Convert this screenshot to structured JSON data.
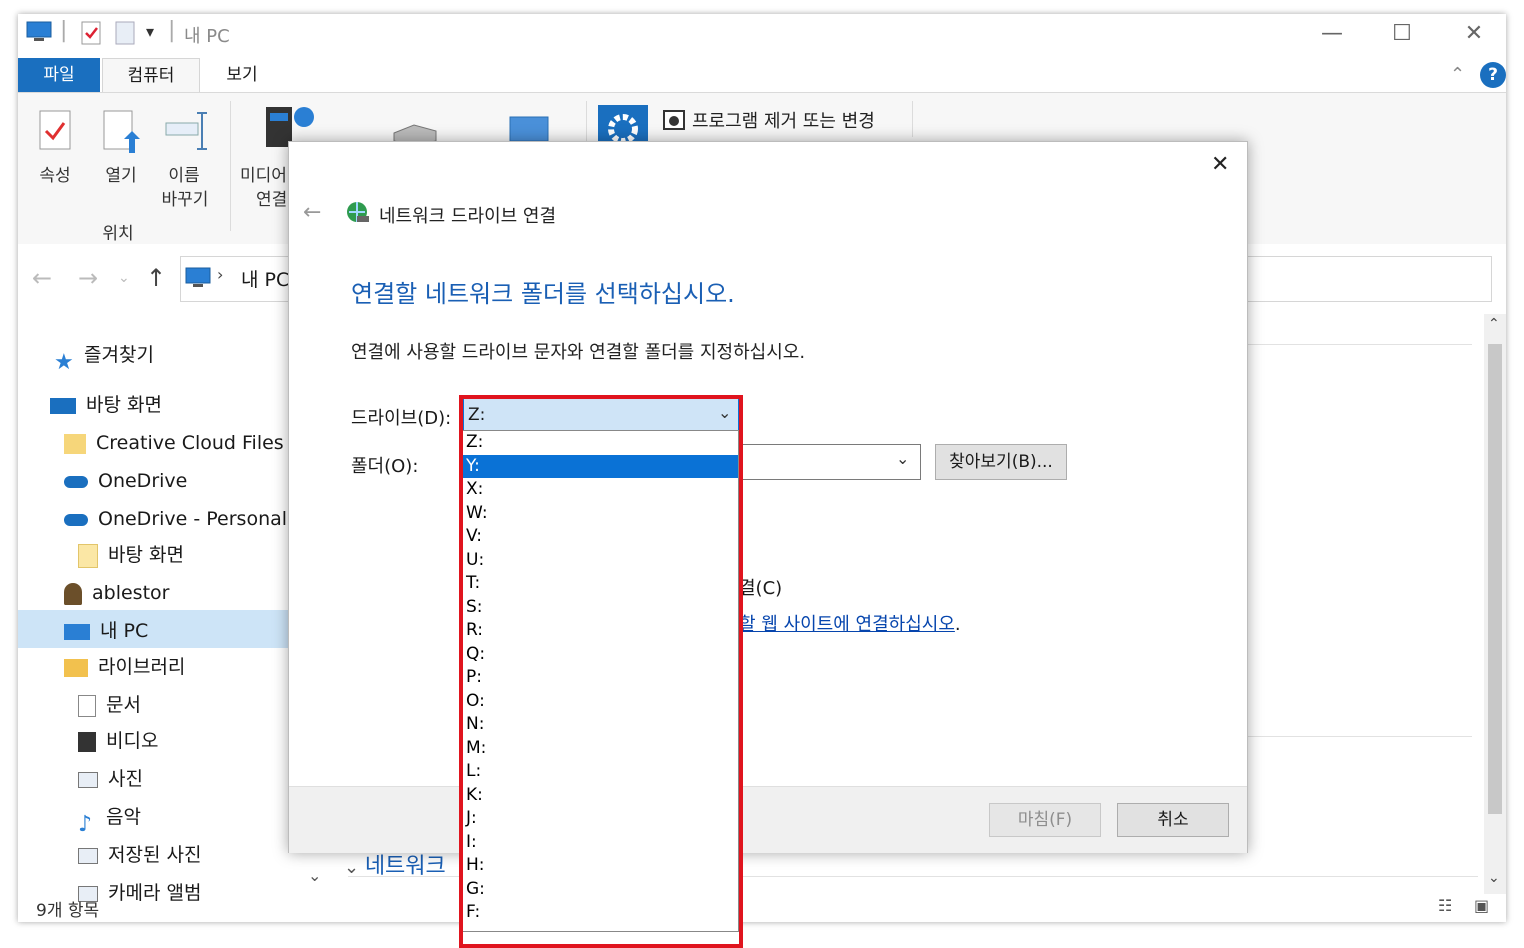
{
  "window": {
    "title": "내 PC"
  },
  "ribbon": {
    "tabs": [
      "파일",
      "컴퓨터",
      "보기"
    ],
    "items": {
      "properties": "속성",
      "open": "열기",
      "rename_1": "이름",
      "rename_2": "바꾸기",
      "media_1": "미디어",
      "media_2": "연결",
      "group_location": "위치",
      "uninstall": "프로그램 제거 또는 변경"
    }
  },
  "address": {
    "path": "내 PC"
  },
  "nav": {
    "items": [
      "즐겨찾기",
      "바탕 화면",
      "Creative Cloud Files",
      "OneDrive",
      "OneDrive - Personal",
      "바탕 화면",
      "ablestor",
      "내 PC",
      "라이브러리",
      "문서",
      "비디오",
      "사진",
      "음악",
      "저장된 사진",
      "카메라 앨범"
    ]
  },
  "status": {
    "count": "9개 항목"
  },
  "content": {
    "network_section": "네트워크"
  },
  "dialog": {
    "title": "네트워크 드라이브 연결",
    "heading": "연결할 네트워크 폴더를 선택하십시오.",
    "description": "연결에 사용할 드라이브 문자와 연결할 폴더를 지정하십시오.",
    "drive_label": "드라이브(D):",
    "drive_value": "Z:",
    "folder_label": "폴더(O):",
    "browse_button": "찾아보기(B)...",
    "partial_checkbox": "결(C)",
    "partial_link": "할 웹 사이트에 연결하십시오",
    "link_period": ".",
    "finish_button": "마침(F)",
    "cancel_button": "취소",
    "drive_options": [
      "Z:",
      "Y:",
      "X:",
      "W:",
      "V:",
      "U:",
      "T:",
      "S:",
      "R:",
      "Q:",
      "P:",
      "O:",
      "N:",
      "M:",
      "L:",
      "K:",
      "J:",
      "I:",
      "H:",
      "G:",
      "F:"
    ],
    "selected_option": "Y:"
  },
  "colors": {
    "accent": "#1a6fbf",
    "selection": "#0a72d6",
    "highlight_border": "#e0141e",
    "heading": "#1a5fb4"
  }
}
